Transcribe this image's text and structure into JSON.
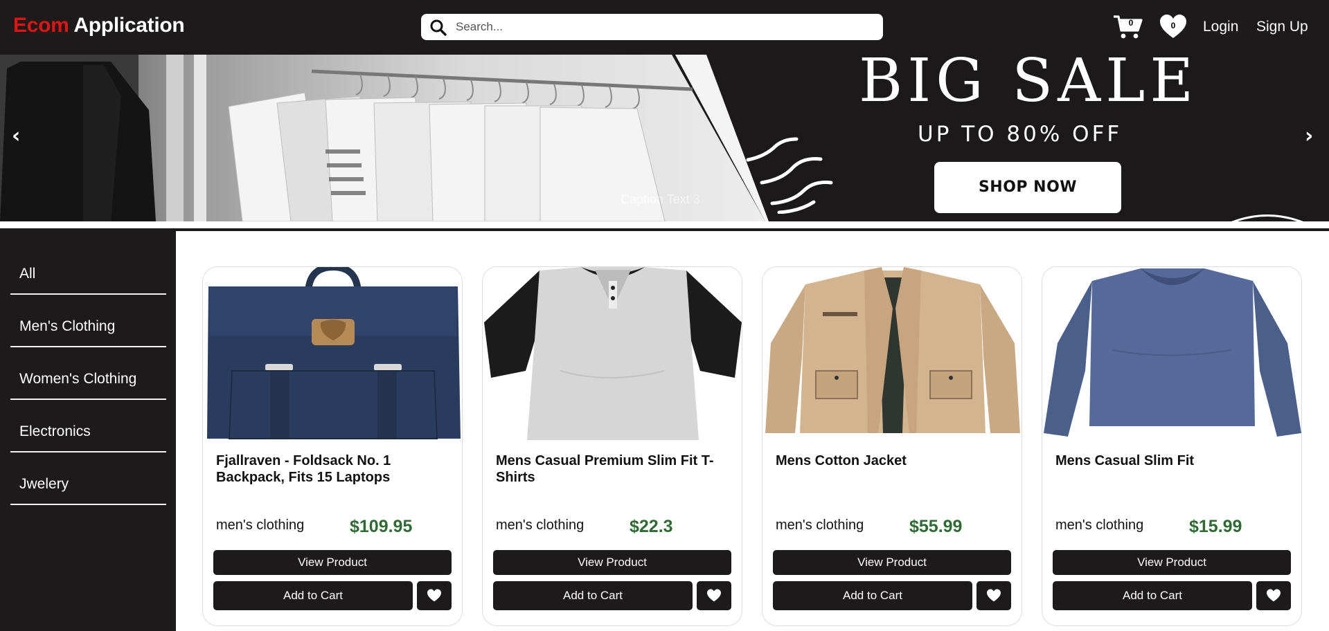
{
  "header": {
    "brand_part1": "Ecom",
    "brand_part2": "Application",
    "search_placeholder": "Search...",
    "cart_count": "0",
    "wishlist_count": "0",
    "login_label": "Login",
    "signup_label": "Sign Up"
  },
  "banner": {
    "title": "BIG SALE",
    "subtitle": "UP TO 80% OFF",
    "cta_label": "SHOP NOW",
    "caption": "Caption Text 3",
    "prev_label": "‹",
    "next_label": "›"
  },
  "sidebar": {
    "categories": [
      {
        "label": "All"
      },
      {
        "label": "Men's Clothing"
      },
      {
        "label": "Women's Clothing"
      },
      {
        "label": "Electronics"
      },
      {
        "label": "Jwelery"
      }
    ]
  },
  "products": [
    {
      "title": "Fjallraven - Foldsack No. 1 Backpack, Fits 15 Laptops",
      "category": "men's clothing",
      "price": "$109.95",
      "view_label": "View Product",
      "cart_label": "Add to Cart",
      "image": "navy-backpack"
    },
    {
      "title": "Mens Casual Premium Slim Fit T-Shirts",
      "category": "men's clothing",
      "price": "$22.3",
      "view_label": "View Product",
      "cart_label": "Add to Cart",
      "image": "raglan-tshirt"
    },
    {
      "title": "Mens Cotton Jacket",
      "category": "men's clothing",
      "price": "$55.99",
      "view_label": "View Product",
      "cart_label": "Add to Cart",
      "image": "khaki-jacket"
    },
    {
      "title": "Mens Casual Slim Fit",
      "category": "men's clothing",
      "price": "$15.99",
      "view_label": "View Product",
      "cart_label": "Add to Cart",
      "image": "blue-longsleeve"
    }
  ],
  "colors": {
    "brand_red": "#e01414",
    "dark": "#1c1a1b",
    "price_green": "#2f6a35"
  }
}
